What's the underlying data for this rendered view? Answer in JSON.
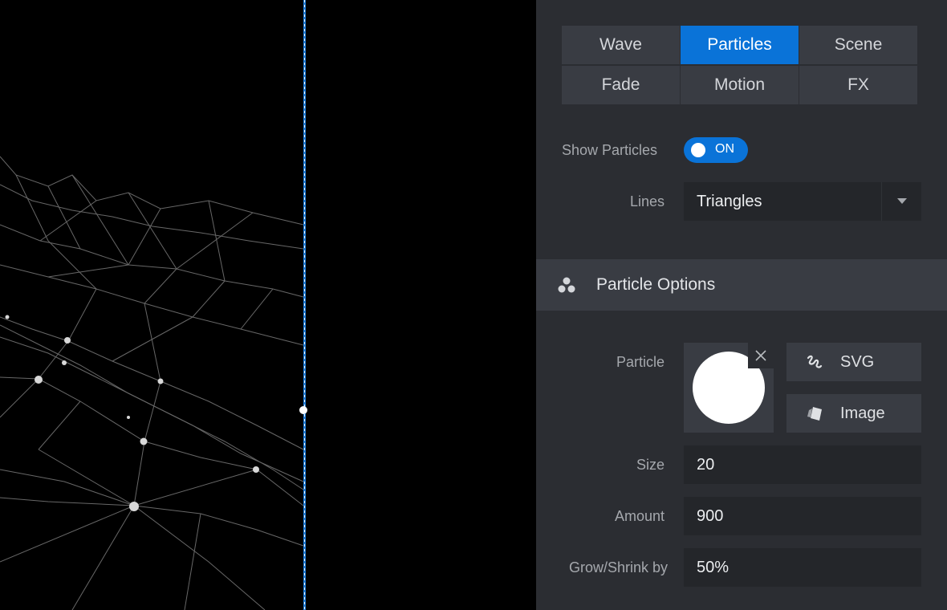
{
  "tabs": [
    {
      "label": "Wave",
      "active": false
    },
    {
      "label": "Particles",
      "active": true
    },
    {
      "label": "Scene",
      "active": false
    },
    {
      "label": "Fade",
      "active": false
    },
    {
      "label": "Motion",
      "active": false
    },
    {
      "label": "FX",
      "active": false
    }
  ],
  "show_particles": {
    "label": "Show Particles",
    "state": "ON"
  },
  "lines": {
    "label": "Lines",
    "value": "Triangles"
  },
  "particle_options": {
    "title": "Particle Options"
  },
  "particle": {
    "label": "Particle",
    "svg_label": "SVG",
    "image_label": "Image"
  },
  "size": {
    "label": "Size",
    "value": "20"
  },
  "amount": {
    "label": "Amount",
    "value": "900"
  },
  "grow": {
    "label": "Grow/Shrink by",
    "value": "50%"
  },
  "colors": {
    "accent": "#0a73d8",
    "panel": "#2b2d32",
    "tab": "#393c43",
    "field": "#24262a",
    "guide": "#1f7bd6"
  }
}
